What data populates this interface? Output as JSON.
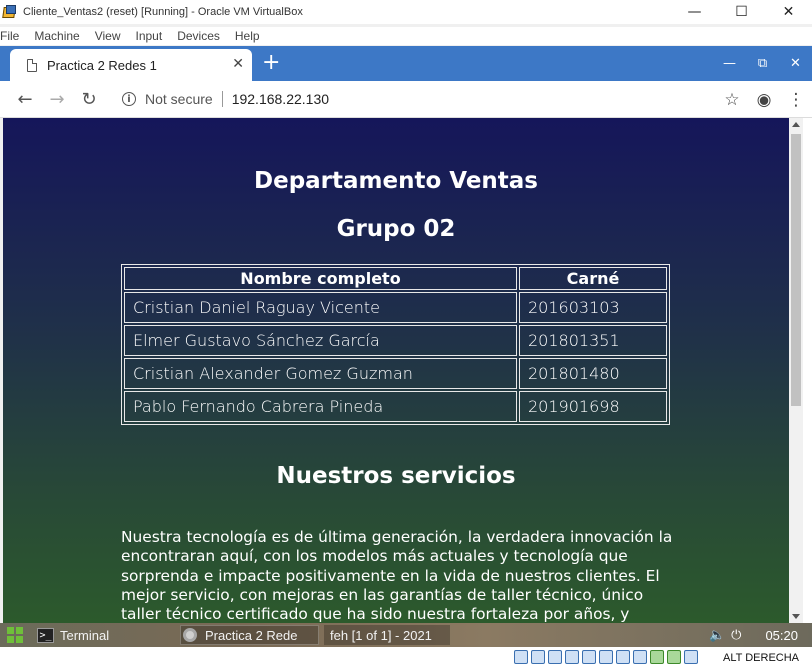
{
  "vbox": {
    "title": "Cliente_Ventas2 (reset) [Running] - Oracle VM VirtualBox",
    "menu": [
      "File",
      "Machine",
      "View",
      "Input",
      "Devices",
      "Help"
    ],
    "host_key": "ALT DERECHA"
  },
  "browser": {
    "tab_title": "Practica 2 Redes 1",
    "security_label": "Not secure",
    "url": "192.168.22.130"
  },
  "page": {
    "heading": "Departamento Ventas",
    "subheading": "Grupo 02",
    "table": {
      "headers": [
        "Nombre completo",
        "Carné"
      ],
      "rows": [
        [
          "Cristian Daniel Raguay Vicente",
          "201603103"
        ],
        [
          "Elmer Gustavo Sánchez García",
          "201801351"
        ],
        [
          "Cristian Alexander Gomez Guzman",
          "201801480"
        ],
        [
          "Pablo Fernando Cabrera Pineda",
          "201901698"
        ]
      ]
    },
    "services_heading": "Nuestros servicios",
    "services_text": "Nuestra tecnología es de última generación, la verdadera innovación la encontraran aquí, con los modelos más actuales y tecnología que sorprenda e impacte positivamente en la vida de nuestros clientes. El mejor servicio, con mejoras en las garantías de taller técnico, único taller técnico certificado que ha sido nuestra fortaleza por años, y"
  },
  "taskbar": {
    "items": [
      "Terminal",
      "Practica 2 Rede",
      "feh [1 of 1] - 2021"
    ],
    "clock": "05:20"
  },
  "colors": {
    "tabstrip": "#3d78c6",
    "page_gradient_top": "#15165a",
    "page_gradient_bottom": "#2c5a2c"
  }
}
